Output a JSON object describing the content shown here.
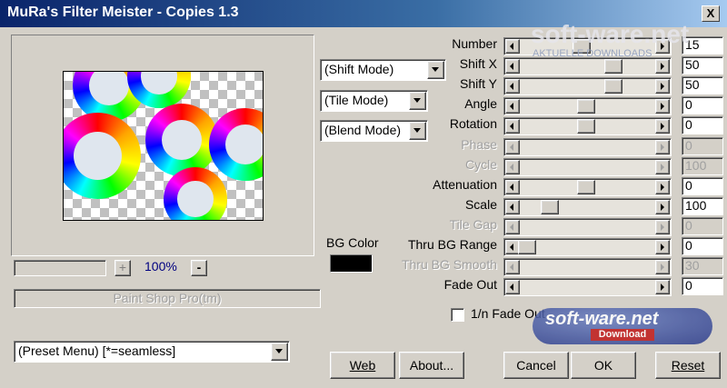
{
  "window": {
    "title": "MuRa's Filter Meister - Copies 1.3",
    "close_label": "X"
  },
  "preview": {
    "zoom": "100%",
    "zoom_plus": "+",
    "zoom_minus": "-",
    "host_app": "Paint Shop Pro(tm)"
  },
  "combos": {
    "shift_mode": "(Shift Mode)",
    "tile_mode": "(Tile Mode)",
    "blend_mode": "(Blend Mode)",
    "preset_menu": "(Preset Menu)  [*=seamless]"
  },
  "bg_color": {
    "label": "BG Color",
    "swatch": "#000000"
  },
  "controls": [
    {
      "label": "Number",
      "value": "15",
      "enabled": true
    },
    {
      "label": "Shift X",
      "value": "50",
      "enabled": true
    },
    {
      "label": "Shift Y",
      "value": "50",
      "enabled": true
    },
    {
      "label": "Angle",
      "value": "0",
      "enabled": true
    },
    {
      "label": "Rotation",
      "value": "0",
      "enabled": true
    },
    {
      "label": "Phase",
      "value": "0",
      "enabled": false
    },
    {
      "label": "Cycle",
      "value": "100",
      "enabled": false
    },
    {
      "label": "Attenuation",
      "value": "0",
      "enabled": true
    },
    {
      "label": "Scale",
      "value": "100",
      "enabled": true
    },
    {
      "label": "Tile Gap",
      "value": "0",
      "enabled": false
    },
    {
      "label": "Thru BG Range",
      "value": "0",
      "enabled": true
    },
    {
      "label": "Thru BG Smooth",
      "value": "30",
      "enabled": false
    },
    {
      "label": "Fade Out",
      "value": "0",
      "enabled": true
    }
  ],
  "checkboxes": {
    "fade_out_1n": "1/n Fade Out"
  },
  "buttons": {
    "web": "Web",
    "about": "About...",
    "cancel": "Cancel",
    "ok": "OK",
    "reset": "Reset"
  },
  "watermark": {
    "top": "soft-ware.net",
    "top_sub": "AKTUELLE DOWNLOADS",
    "badge": "soft-ware.net",
    "badge_sub": "Download"
  }
}
